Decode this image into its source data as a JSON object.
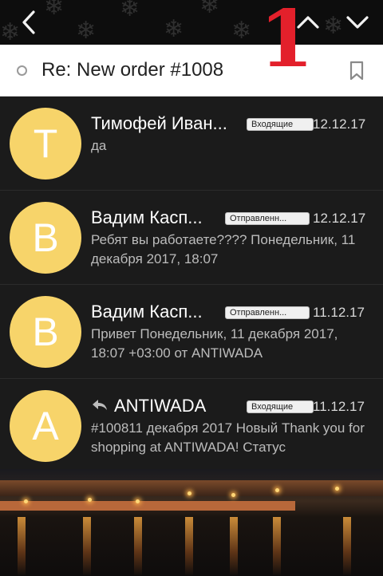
{
  "subject": "Re: New order #1008",
  "annotation_mark": "1",
  "messages": [
    {
      "initial": "T",
      "sender": "Тимофей Иван...",
      "badge": "Входящие",
      "date": "12.12.17",
      "preview": "да",
      "reply": false
    },
    {
      "initial": "B",
      "sender": "Вадим Касп...",
      "badge": "Отправленн...",
      "date": "12.12.17",
      "preview": "Ребят вы работаете???? Понедельник, 11 декабря 2017, 18:07",
      "reply": false
    },
    {
      "initial": "B",
      "sender": "Вадим Касп...",
      "badge": "Отправленн...",
      "date": "11.12.17",
      "preview": "Привет Понедельник, 11 декабря 2017, 18:07 +03:00 от ANTIWADA",
      "reply": false
    },
    {
      "initial": "A",
      "sender": "ANTIWADA",
      "badge": "Входящие",
      "date": "11.12.17",
      "preview": "#100811 декабря 2017 Новый Thank you for shopping at ANTIWADA! Статус",
      "reply": true
    }
  ],
  "icons": {
    "back": "chevron-left-icon",
    "prev": "chevron-up-icon",
    "next": "chevron-down-icon",
    "bookmark": "bookmark-icon",
    "reply": "reply-icon"
  },
  "colors": {
    "avatar": "#f7d46a",
    "annotation": "#e3202b",
    "list_bg": "#1b1b1b"
  }
}
